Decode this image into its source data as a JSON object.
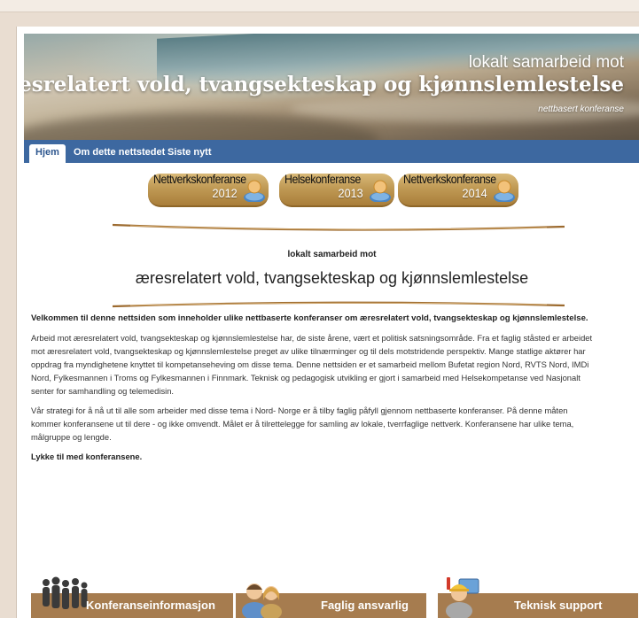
{
  "banner": {
    "line1": "lokalt samarbeid mot",
    "line2": "æresrelatert vold, tvangsekteskap og kjønnslemlestelse",
    "line3": "nettbasert konferanse"
  },
  "nav": {
    "tabs": [
      {
        "label": "Hjem"
      },
      {
        "label": "Om dette nettstedet"
      },
      {
        "label": "Siste nytt"
      }
    ]
  },
  "conferences": [
    {
      "title": "Nettverkskonferanse",
      "year": "2012"
    },
    {
      "title": "Helsekonferanse",
      "year": "2013"
    },
    {
      "title": "Nettverkskonferanse",
      "year": "2014"
    }
  ],
  "heading": {
    "subtitle": "lokalt samarbeid mot",
    "title": "æresrelatert vold, tvangsekteskap og kjønnslemlestelse"
  },
  "content": {
    "lead": "Velkommen til denne nettsiden som inneholder ulike nettbaserte konferanser om æresrelatert vold, tvangsekteskap og kjønnslemlestelse.",
    "para1": "Arbeid mot æresrelatert vold, tvangsekteskap og kjønnslemlestelse har, de siste årene, vært et politisk satsningsområde. Fra et faglig ståsted er arbeidet mot æresrelatert vold, tvangsekteskap og kjønnslemlestelse preget av ulike tilnærminger og til dels motstridende perspektiv. Mange statlige aktører har oppdrag fra myndighetene knyttet til kompetanseheving om disse tema. Denne nettsiden er et samarbeid mellom Bufetat region Nord, RVTS Nord, IMDi Nord, Fylkesmannen i Troms og Fylkesmannen i Finnmark. Teknisk og pedagogisk utvikling er gjort i samarbeid med Helsekompetanse ved Nasjonalt senter for samhandling og telemedisin.",
    "para2": "Vår strategi for å nå ut til alle som arbeider med disse tema i Nord- Norge er å tilby faglig påfyll gjennom nettbaserte konferanser. På denne måten kommer konferansene ut til dere - og ikke omvendt. Målet er å tilrettelegge for samling av lokale, tverrfaglige nettverk. Konferansene har ulike tema, målgruppe og lengde.",
    "closing": "Lykke til med konferansene."
  },
  "bottom_buttons": [
    {
      "label": "Konferanseinformasjon",
      "icon": "people-group-icon"
    },
    {
      "label": "Faglig ansvarlig",
      "icon": "two-persons-icon"
    },
    {
      "label": "Teknisk support",
      "icon": "support-worker-icon"
    }
  ],
  "colors": {
    "nav_blue": "#3d68a0",
    "gold_button": "#c09a55",
    "bottom_bar": "#a67c4f",
    "swoosh": "#9c6a2e"
  }
}
